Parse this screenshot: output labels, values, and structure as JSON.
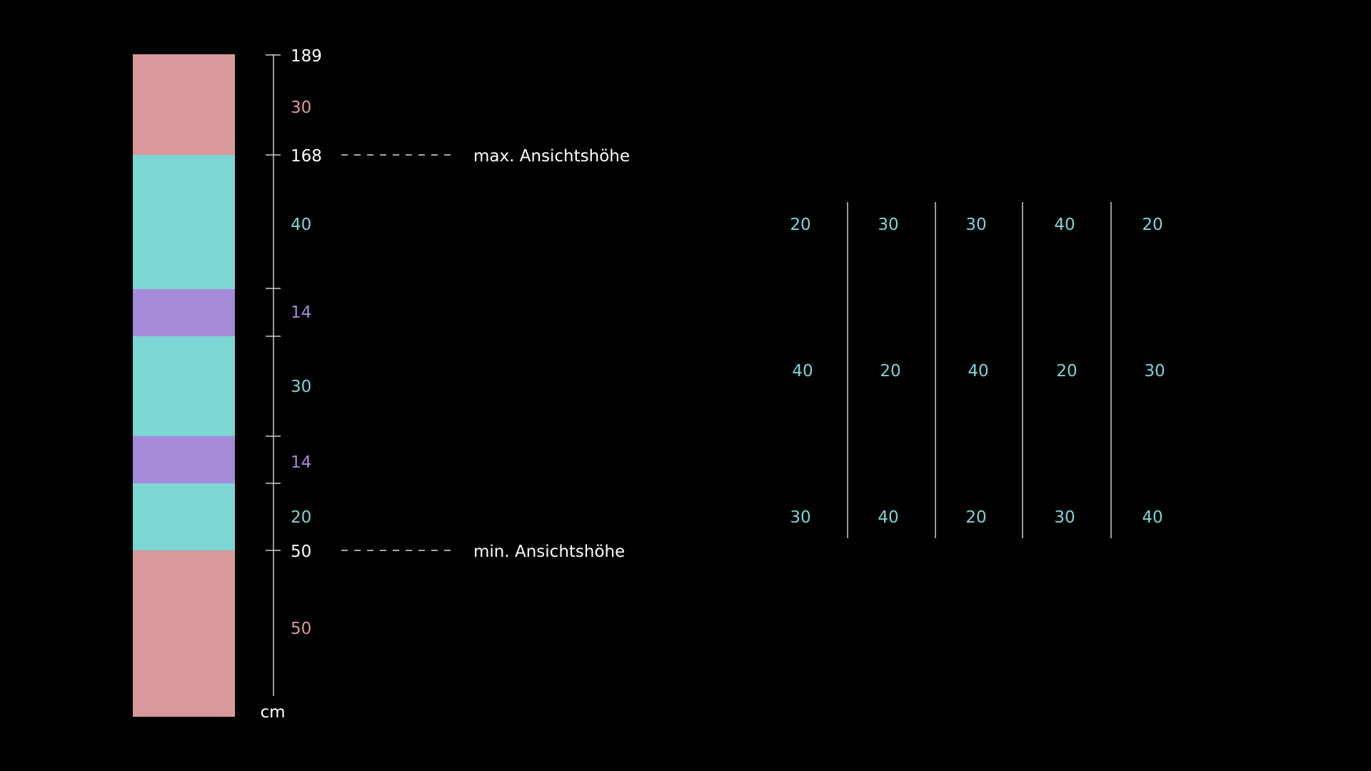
{
  "colors": {
    "background": "#000000",
    "pink": "#d89a9a",
    "teal": "#7dd5d4",
    "purple": "#a58ad8",
    "white": "#ffffff",
    "line": "#cccccc"
  },
  "unit_label": "cm",
  "column_bar": {
    "segments": [
      {
        "value": "30",
        "color": "pink"
      },
      {
        "value": "40",
        "color": "teal"
      },
      {
        "value": "14",
        "color": "purple"
      },
      {
        "value": "30",
        "color": "teal"
      },
      {
        "value": "14",
        "color": "purple"
      },
      {
        "value": "20",
        "color": "teal"
      },
      {
        "value": "50",
        "color": "pink"
      }
    ]
  },
  "scale_marks": [
    {
      "value": "189"
    },
    {
      "value": "168",
      "note": "max. Ansichtshöhe"
    },
    {
      "value": "50",
      "note": "min. Ansichtshöhe"
    }
  ],
  "grid": {
    "rows": [
      [
        "20",
        "30",
        "30",
        "40",
        "20"
      ],
      [
        "40",
        "20",
        "40",
        "20",
        "30"
      ],
      [
        "30",
        "40",
        "20",
        "30",
        "40"
      ]
    ]
  }
}
